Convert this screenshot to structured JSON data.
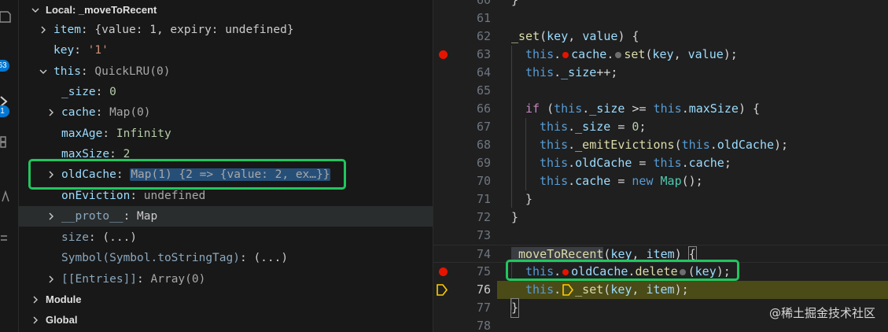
{
  "variables": {
    "scope_title": "Local: _moveToRecent",
    "rows": [
      {
        "name": "item",
        "value": "{value: 1, expiry: undefined}"
      },
      {
        "name": "key",
        "value": "'1'"
      },
      {
        "name": "this",
        "value": "QuickLRU(0)"
      },
      {
        "name": "_size",
        "value": "0"
      },
      {
        "name": "cache",
        "value": "Map(0)"
      },
      {
        "name": "maxAge",
        "value": "Infinity"
      },
      {
        "name": "maxSize",
        "value": "2"
      },
      {
        "name": "oldCache",
        "value": "Map(1) {2 => {value: 2, ex…}}"
      },
      {
        "name": "onEviction",
        "value": "undefined"
      },
      {
        "name": "__proto__",
        "value": "Map"
      },
      {
        "name": "size",
        "value": "(...)"
      },
      {
        "name": "Symbol(Symbol.toStringTag)",
        "value": "(...)"
      },
      {
        "name": "[[Entries]]",
        "value": "Array(0)"
      }
    ],
    "sections": [
      "Module",
      "Global"
    ]
  },
  "activity_bar": {
    "badges": [
      "63",
      "1"
    ]
  },
  "editor": {
    "lines": [
      {
        "n": "60",
        "text": "}"
      },
      {
        "n": "61",
        "text": ""
      },
      {
        "n": "62",
        "text": "_set(key, value) {"
      },
      {
        "n": "63",
        "text": "this.cache.set(key, value);"
      },
      {
        "n": "64",
        "text": "this._size++;"
      },
      {
        "n": "65",
        "text": ""
      },
      {
        "n": "66",
        "text": "if (this._size >= this.maxSize) {"
      },
      {
        "n": "67",
        "text": "this._size = 0;"
      },
      {
        "n": "68",
        "text": "this._emitEvictions(this.oldCache);"
      },
      {
        "n": "69",
        "text": "this.oldCache = this.cache;"
      },
      {
        "n": "70",
        "text": "this.cache = new Map();"
      },
      {
        "n": "71",
        "text": "}"
      },
      {
        "n": "72",
        "text": "}"
      },
      {
        "n": "73",
        "text": ""
      },
      {
        "n": "74",
        "text": "_moveToRecent(key, item) {"
      },
      {
        "n": "75",
        "text": "this.oldCache.delete(key);"
      },
      {
        "n": "76",
        "text": "this._set(key, item);"
      },
      {
        "n": "77",
        "text": "}"
      },
      {
        "n": "78",
        "text": ""
      }
    ],
    "breakpoint_lines": [
      "63",
      "75"
    ],
    "current_line": "76"
  },
  "watermark": "@稀土掘金技术社区",
  "colors": {
    "highlight_box": "#22c55e",
    "breakpoint": "#e51400",
    "current_line_bg": "#4b4b18",
    "keyword": "#c586c0",
    "property": "#9cdcfe",
    "function": "#dcdcaa"
  },
  "icons": [
    "chevron-right-icon",
    "chevron-down-icon",
    "breakpoint-icon",
    "debug-stackframe-icon"
  ]
}
